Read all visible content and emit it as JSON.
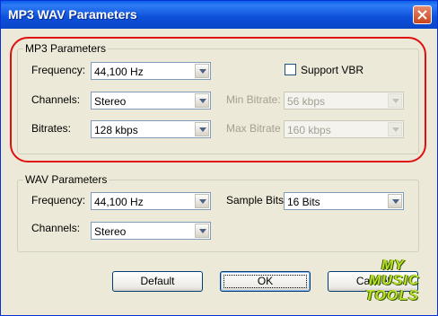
{
  "window": {
    "title": "MP3 WAV Parameters"
  },
  "mp3": {
    "group_label": "MP3 Parameters",
    "frequency_label": "Frequency:",
    "frequency_value": "44,100 Hz",
    "channels_label": "Channels:",
    "channels_value": "Stereo",
    "bitrates_label": "Bitrates:",
    "bitrates_value": "128 kbps",
    "support_vbr_label": "Support VBR",
    "support_vbr_checked": false,
    "min_bitrate_label": "Min Bitrate:",
    "min_bitrate_value": "56 kbps",
    "max_bitrate_label": "Max Bitrate",
    "max_bitrate_value": "160 kbps"
  },
  "wav": {
    "group_label": "WAV Parameters",
    "frequency_label": "Frequency:",
    "frequency_value": "44,100 Hz",
    "channels_label": "Channels:",
    "channels_value": "Stereo",
    "sample_bits_label": "Sample Bits:",
    "sample_bits_value": "16 Bits"
  },
  "buttons": {
    "default_label": "Default",
    "ok_label": "OK",
    "cancel_label": "Cancel"
  },
  "watermark": {
    "line1": "MY",
    "line2": "MUSIC",
    "line3": "TOOLS"
  },
  "colors": {
    "titlebar": "#0a5fe8",
    "dialog": "#ece9d8",
    "highlight": "#e01010",
    "watermark": "#b9e12b"
  }
}
